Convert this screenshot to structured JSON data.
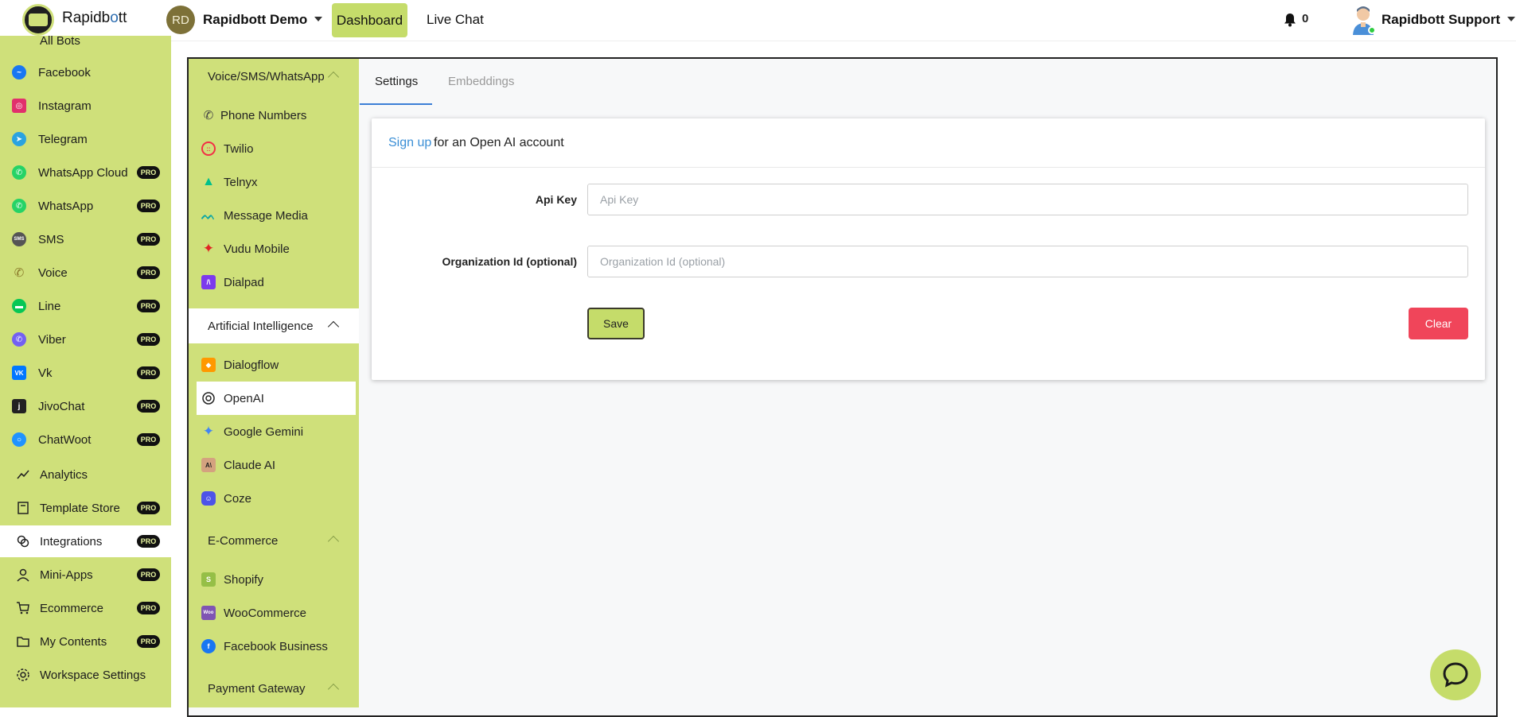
{
  "header": {
    "brand": "Rapidb",
    "brand_o": "o",
    "brand_end": "tt",
    "workspace_initials": "RD",
    "workspace_name": "Rapidbott Demo",
    "nav_dashboard": "Dashboard",
    "nav_livechat": "Live Chat",
    "notification_count": "0",
    "user_name": "Rapidbott Support"
  },
  "sidebar": {
    "top_item": "All Bots",
    "pro_badge": "PRO",
    "items": [
      {
        "label": "Facebook",
        "icon": "messenger-icon",
        "color": "#1877f2"
      },
      {
        "label": "Instagram",
        "icon": "instagram-icon",
        "color": "#e1306c"
      },
      {
        "label": "Telegram",
        "icon": "telegram-icon",
        "color": "#2aa3e0"
      },
      {
        "label": "WhatsApp Cloud",
        "icon": "whatsapp-icon",
        "color": "#25d366",
        "pro": true
      },
      {
        "label": "WhatsApp",
        "icon": "whatsapp-icon",
        "color": "#25d366",
        "pro": true
      },
      {
        "label": "SMS",
        "icon": "sms-icon",
        "color": "#555555",
        "pro": true
      },
      {
        "label": "Voice",
        "icon": "phone-icon",
        "color": "#c9a227",
        "pro": true
      },
      {
        "label": "Line",
        "icon": "line-icon",
        "color": "#06c755",
        "pro": true
      },
      {
        "label": "Viber",
        "icon": "viber-icon",
        "color": "#7360f2",
        "pro": true
      },
      {
        "label": "Vk",
        "icon": "vk-icon",
        "color": "#0077ff",
        "pro": true
      },
      {
        "label": "JivoChat",
        "icon": "jivochat-icon",
        "color": "#222222",
        "pro": true
      },
      {
        "label": "ChatWoot",
        "icon": "chatwoot-icon",
        "color": "#1f93ff",
        "pro": true
      }
    ],
    "menu": [
      {
        "label": "Analytics",
        "icon": "analytics-icon"
      },
      {
        "label": "Template Store",
        "icon": "template-icon",
        "pro": true
      },
      {
        "label": "Integrations",
        "icon": "integrations-icon",
        "pro": true,
        "active": true
      },
      {
        "label": "Mini-Apps",
        "icon": "user-icon",
        "pro": true
      },
      {
        "label": "Ecommerce",
        "icon": "cart-icon",
        "pro": true
      },
      {
        "label": "My Contents",
        "icon": "folder-icon",
        "pro": true
      },
      {
        "label": "Workspace Settings",
        "icon": "gear-icon"
      }
    ]
  },
  "subnav": {
    "voice_section": "Voice/SMS/WhatsApp",
    "voice_items": [
      {
        "label": "Phone Numbers",
        "icon": "phone-icon",
        "color": "#444444"
      },
      {
        "label": "Twilio",
        "icon": "twilio-icon",
        "color": "#f22f46"
      },
      {
        "label": "Telnyx",
        "icon": "telnyx-icon",
        "color": "#00c08b"
      },
      {
        "label": "Message Media",
        "icon": "messagemedia-icon",
        "color": "#0aa5a5"
      },
      {
        "label": "Vudu Mobile",
        "icon": "vudu-icon",
        "color": "#e02424"
      },
      {
        "label": "Dialpad",
        "icon": "dialpad-icon",
        "color": "#7c3aed"
      }
    ],
    "ai_section": "Artificial Intelligence",
    "ai_items": [
      {
        "label": "Dialogflow",
        "icon": "dialogflow-icon",
        "color": "#ff9800"
      },
      {
        "label": "OpenAI",
        "icon": "openai-icon",
        "color": "#222222",
        "active": true
      },
      {
        "label": "Google Gemini",
        "icon": "gemini-icon",
        "color": "#4285f4"
      },
      {
        "label": "Claude AI",
        "icon": "claude-icon",
        "color": "#d4a27f"
      },
      {
        "label": "Coze",
        "icon": "coze-icon",
        "color": "#4d53e8"
      }
    ],
    "ecommerce_section": "E-Commerce",
    "ecommerce_items": [
      {
        "label": "Shopify",
        "icon": "shopify-icon",
        "color": "#95bf47"
      },
      {
        "label": "WooCommerce",
        "icon": "woocommerce-icon",
        "color": "#7f54b3"
      },
      {
        "label": "Facebook Business",
        "icon": "facebook-icon",
        "color": "#1877f2"
      }
    ],
    "payment_section": "Payment Gateway"
  },
  "tabs": {
    "settings": "Settings",
    "embeddings": "Embeddings"
  },
  "card": {
    "signup_link": "Sign up",
    "signup_rest": "for an Open AI account",
    "api_key_label": "Api Key",
    "api_key_placeholder": "Api Key",
    "org_label": "Organization Id (optional)",
    "org_placeholder": "Organization Id (optional)",
    "save": "Save",
    "clear": "Clear"
  }
}
